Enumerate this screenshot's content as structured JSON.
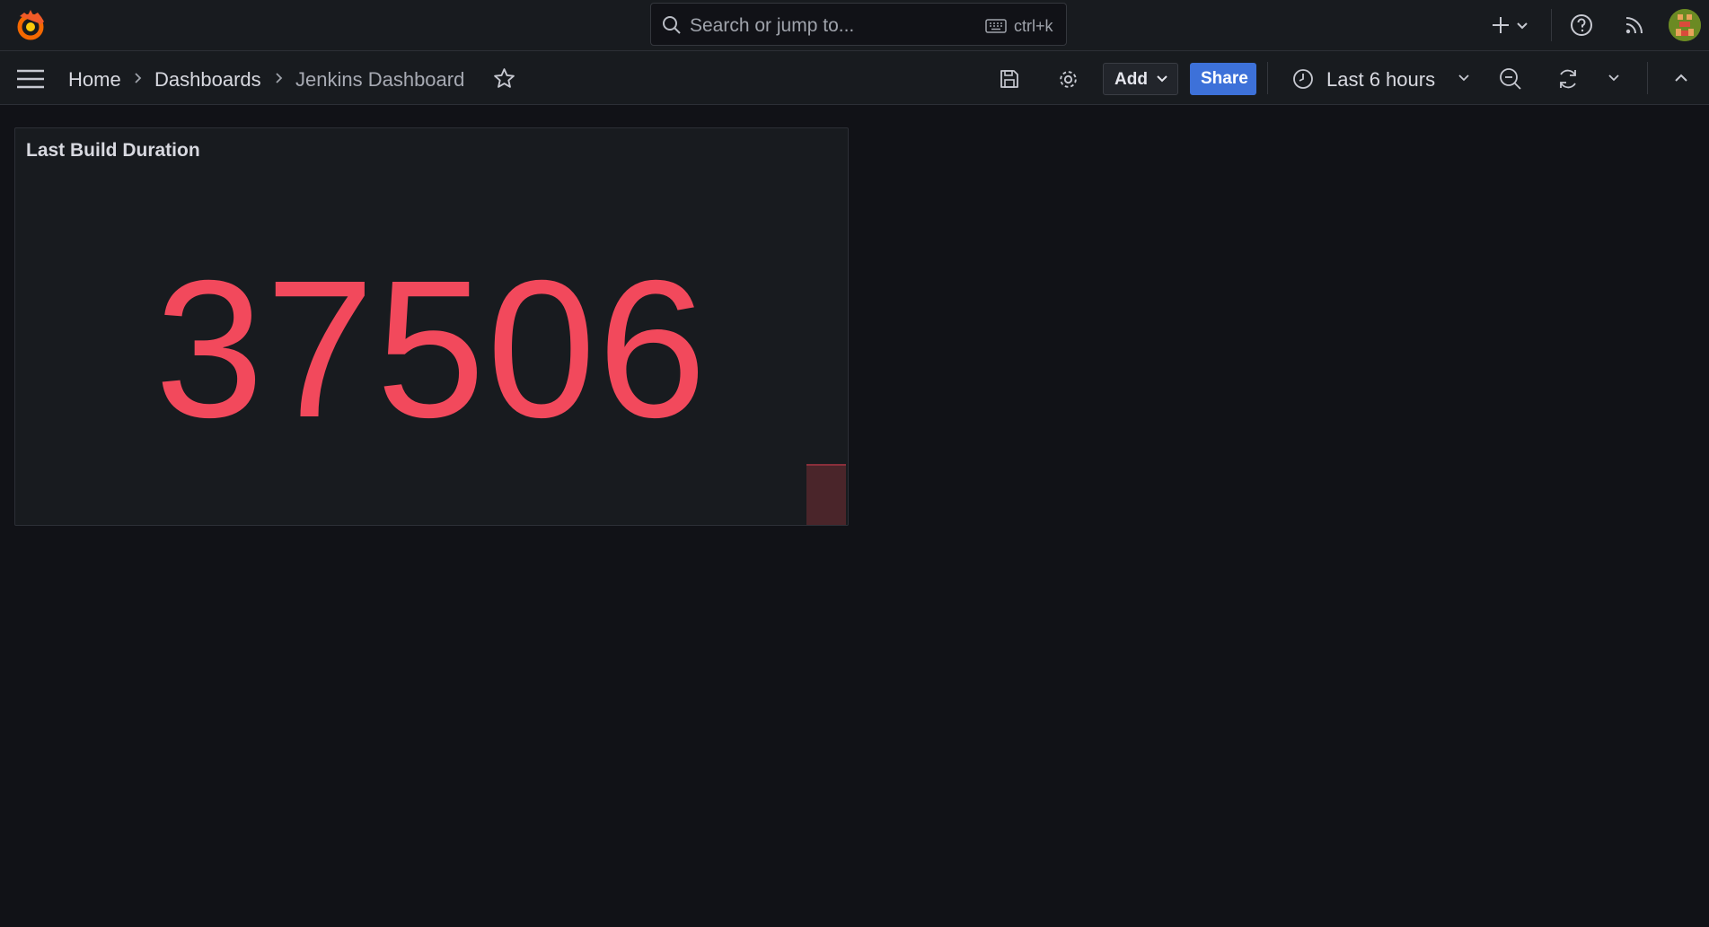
{
  "search": {
    "placeholder": "Search or jump to...",
    "shortcut": "ctrl+k"
  },
  "breadcrumb": {
    "home": "Home",
    "dashboards": "Dashboards",
    "current": "Jenkins Dashboard"
  },
  "toolbar": {
    "add_label": "Add",
    "share_label": "Share",
    "time_range": "Last 6 hours"
  },
  "panel": {
    "title": "Last Build Duration",
    "value": "37506"
  },
  "colors": {
    "accent": "#3d71d9",
    "stat": "#f2495c",
    "background": "#111217",
    "panel": "#181b1f"
  },
  "icons": [
    "grafana-logo",
    "search-icon",
    "keyboard-icon",
    "plus-icon",
    "help-icon",
    "rss-icon",
    "menu-icon",
    "star-icon",
    "save-icon",
    "gear-icon",
    "clock-icon",
    "zoom-out-icon",
    "refresh-icon",
    "chevron-up-icon"
  ]
}
